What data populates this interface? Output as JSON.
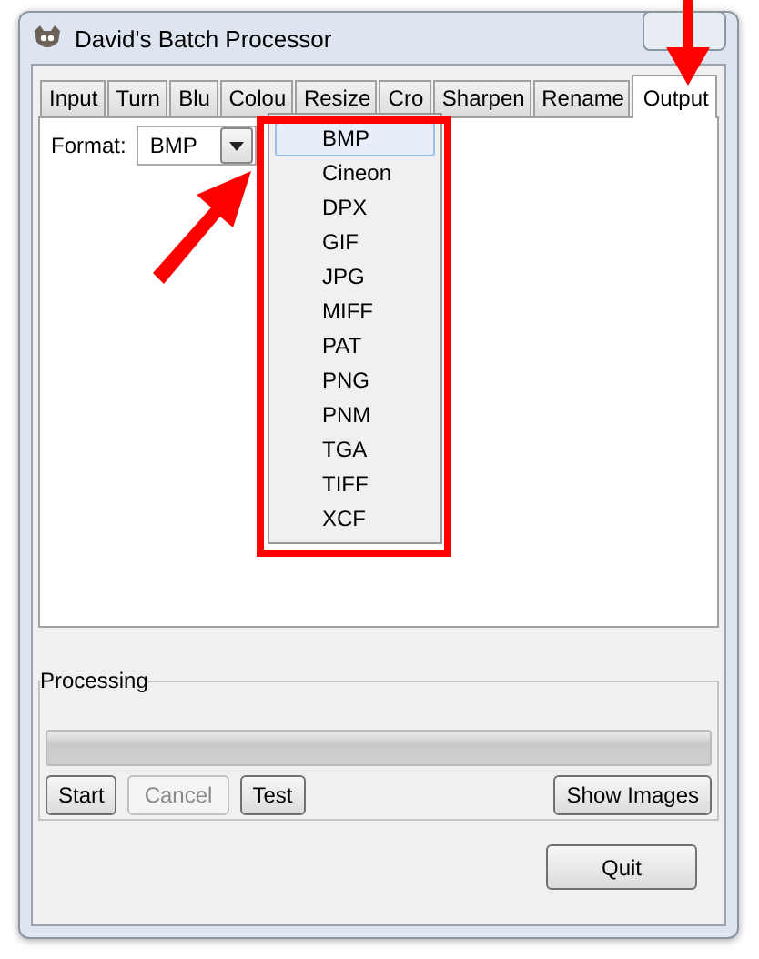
{
  "window": {
    "title": "David's Batch Processor"
  },
  "tabs": [
    {
      "label": "Input",
      "selected": false
    },
    {
      "label": "Turn",
      "selected": false
    },
    {
      "label": "Blu",
      "selected": false
    },
    {
      "label": "Colou",
      "selected": false
    },
    {
      "label": "Resize",
      "selected": false
    },
    {
      "label": "Cro",
      "selected": false
    },
    {
      "label": "Sharpen",
      "selected": false
    },
    {
      "label": "Rename",
      "selected": false
    },
    {
      "label": "Output",
      "selected": true
    }
  ],
  "format": {
    "label": "Format:",
    "value": "BMP",
    "options": [
      {
        "label": "BMP",
        "selected": true
      },
      {
        "label": "Cineon",
        "selected": false
      },
      {
        "label": "DPX",
        "selected": false
      },
      {
        "label": "GIF",
        "selected": false
      },
      {
        "label": "JPG",
        "selected": false
      },
      {
        "label": "MIFF",
        "selected": false
      },
      {
        "label": "PAT",
        "selected": false
      },
      {
        "label": "PNG",
        "selected": false
      },
      {
        "label": "PNM",
        "selected": false
      },
      {
        "label": "TGA",
        "selected": false
      },
      {
        "label": "TIFF",
        "selected": false
      },
      {
        "label": "XCF",
        "selected": false
      }
    ]
  },
  "processing": {
    "title": "Processing",
    "progress": {
      "level": 0
    },
    "buttons": [
      {
        "label": "Start",
        "disabled": false
      },
      {
        "label": "Cancel",
        "disabled": true
      },
      {
        "label": "Test",
        "disabled": false
      },
      {
        "label": "Show Images",
        "disabled": false
      }
    ]
  },
  "buttons": [
    {
      "label": "Quit"
    }
  ]
}
